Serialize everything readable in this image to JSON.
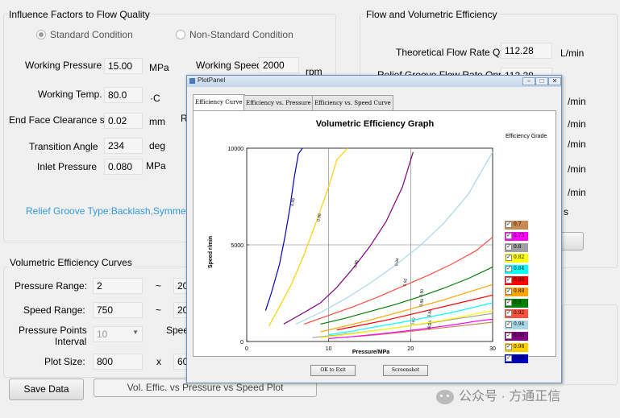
{
  "influence": {
    "title": "Influence Factors to  Flow Quality",
    "radio_standard": "Standard Condition",
    "radio_nonstandard": "Non-Standard Condition",
    "working_pressure_label": "Working Pressure",
    "working_pressure_value": "15.00",
    "working_pressure_unit": "MPa",
    "working_speed_label": "Working Speed",
    "working_speed_value": "2000",
    "working_speed_unit": "rpm",
    "working_temp_label": "Working Temp.",
    "working_temp_value": "80.0",
    "working_temp_unit": "·C",
    "clearance_label": "End Face Clearance s",
    "clearance_value": "0.02",
    "clearance_unit": "mm",
    "clearance_extra": "R",
    "transition_label": "Transition Angle",
    "transition_value": "234",
    "transition_unit": "deg",
    "inlet_label": "Inlet Pressure",
    "inlet_value": "0.080",
    "inlet_unit": "MPa",
    "relief_type": "Relief Groove Type:Backlash,Symmetrica"
  },
  "flow": {
    "title": "Flow and Volumetric Efficiency",
    "theoretical_label": "Theoretical Flow Rate Qt",
    "theoretical_value": "112.28",
    "theoretical_unit": "L/min",
    "relief_flow_label": "Relief Groove Flow Rate Qnrs",
    "relief_flow_value": "112.28",
    "unit_rows": [
      "/min",
      "/min",
      "/min",
      "/min",
      "/min"
    ],
    "partial_s": "s"
  },
  "curves": {
    "title": "Volumetric Efficiency Curves",
    "pressure_range_label": "Pressure Range:",
    "pressure_from": "2",
    "pressure_to": "20",
    "speed_range_label": "Speed Range:",
    "speed_from": "750",
    "speed_to": "20",
    "points_label_1": "Pressure Points",
    "points_label_2": "Interval",
    "points_value": "10",
    "speed_partial": "Speed",
    "plot_size_label": "Plot Size:",
    "plot_w": "800",
    "plot_x": "x",
    "plot_h": "60",
    "tilde": "~",
    "save_button": "Save Data",
    "plot_button": "Vol. Effic. vs Pressure vs Speed Plot"
  },
  "plotpanel": {
    "window_title": "PlotPanel",
    "tabs": [
      "Efficiency Curve",
      "Efficiency vs. Pressure",
      "Efficiency vs. Speed Curve"
    ],
    "ok_button": "OK to Exit",
    "screenshot_button": "Screenshot"
  },
  "watermark": "公众号 · 方通正信",
  "chart_data": {
    "type": "line",
    "title": "Volumetric Efficiency Graph",
    "xlabel": "Pressure/MPa",
    "ylabel": "Speed r/min",
    "xlim": [
      0,
      30
    ],
    "ylim": [
      0,
      10000
    ],
    "xticks": [
      "0",
      "10",
      "20",
      "30"
    ],
    "yticks": [
      "0",
      "5000",
      "10000"
    ],
    "grid": true,
    "legend_title": "Efficiency Grade",
    "legend_position": "right",
    "series": [
      {
        "name": "0.7",
        "color": "#c88a50",
        "label": "0.70",
        "x": [
          13,
          16,
          19,
          22,
          25,
          28,
          30
        ],
        "y": [
          250,
          350,
          480,
          620,
          760,
          900,
          1000
        ]
      },
      {
        "name": "0.75",
        "color": "#ff00ff",
        "label": "0.75",
        "x": [
          10,
          13,
          16,
          19,
          22,
          25,
          28,
          30
        ],
        "y": [
          150,
          260,
          380,
          520,
          680,
          850,
          1050,
          1150
        ]
      },
      {
        "name": "0.8",
        "color": "#a0a0a0",
        "label": "0.80",
        "x": [
          8,
          11,
          14,
          17,
          20,
          23,
          26,
          30
        ],
        "y": [
          200,
          330,
          480,
          640,
          820,
          1000,
          1200,
          1450
        ]
      },
      {
        "name": "0.82",
        "color": "#ffff00",
        "label": "",
        "x": [
          9,
          12,
          15,
          18,
          21,
          24,
          27,
          30
        ],
        "y": [
          200,
          350,
          520,
          700,
          900,
          1100,
          1350,
          1600
        ]
      },
      {
        "name": "0.84",
        "color": "#00ffff",
        "label": "0.84",
        "x": [
          10,
          13,
          16,
          19,
          22,
          25,
          28,
          30
        ],
        "y": [
          350,
          550,
          780,
          1000,
          1250,
          1500,
          1800,
          2000
        ]
      },
      {
        "name": "0.86",
        "color": "#ff0000",
        "label": "",
        "x": [
          11,
          14,
          17,
          20,
          23,
          26,
          30
        ],
        "y": [
          600,
          850,
          1100,
          1400,
          1700,
          2000,
          2400
        ]
      },
      {
        "name": "0.88",
        "color": "#ffa500",
        "label": "0.88",
        "x": [
          9,
          12,
          15,
          18,
          21,
          24,
          27,
          30
        ],
        "y": [
          500,
          800,
          1100,
          1450,
          1800,
          2150,
          2550,
          2950
        ]
      },
      {
        "name": "0.9",
        "color": "#008000",
        "label": "0.90",
        "x": [
          9,
          12,
          15,
          18,
          21,
          24,
          27,
          30
        ],
        "y": [
          900,
          1200,
          1550,
          1900,
          2300,
          2750,
          3250,
          3850
        ]
      },
      {
        "name": "0.92",
        "color": "#ff5040",
        "label": "0.92",
        "x": [
          7,
          10,
          13,
          16,
          19,
          22,
          25,
          28,
          30
        ],
        "y": [
          900,
          1350,
          1800,
          2300,
          2850,
          3400,
          4000,
          4700,
          5400
        ]
      },
      {
        "name": "0.94",
        "color": "#a8d8e8",
        "label": "0.94",
        "x": [
          6,
          9,
          12,
          15,
          18,
          21,
          24,
          27,
          30
        ],
        "y": [
          900,
          1500,
          2200,
          3000,
          3900,
          4900,
          6100,
          7600,
          9800
        ]
      },
      {
        "name": "0.96",
        "color": "#800080",
        "label": "0.96",
        "x": [
          4.5,
          7,
          9,
          11,
          13,
          15,
          17,
          19,
          20.3
        ],
        "y": [
          900,
          1500,
          2000,
          2800,
          3800,
          4900,
          6200,
          8000,
          9800
        ]
      },
      {
        "name": "0.98",
        "color": "#ffd000",
        "label": "0.98",
        "x": [
          2.7,
          4,
          5.5,
          7,
          8.5,
          10,
          11,
          12.3
        ],
        "y": [
          800,
          1800,
          3000,
          4500,
          6200,
          8000,
          9400,
          10000
        ]
      },
      {
        "name": "0.99",
        "color": "#0000c0",
        "label": "0.99",
        "x": [
          2.3,
          3,
          4,
          4.7,
          5.3,
          5.8,
          6.3,
          6.8
        ],
        "y": [
          1600,
          2500,
          4000,
          5500,
          7000,
          8500,
          9700,
          10000
        ]
      }
    ]
  }
}
